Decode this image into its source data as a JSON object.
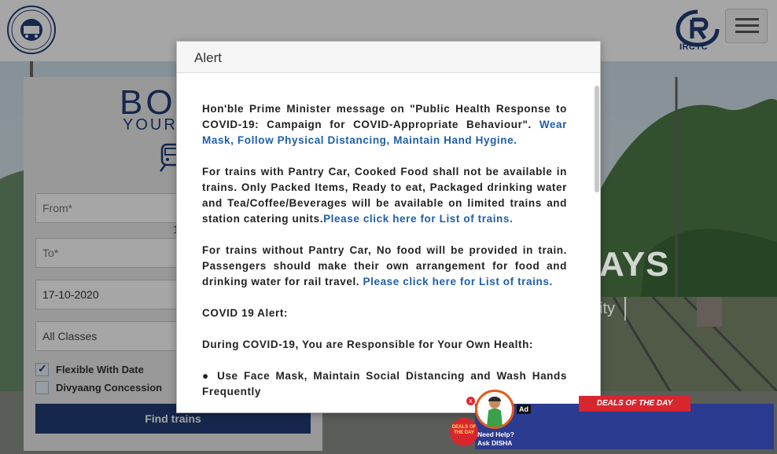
{
  "header": {
    "irctc_label": "IRCTC"
  },
  "booking": {
    "title": "BOOK",
    "subtitle": "YOUR TICKET",
    "from_placeholder": "From*",
    "to_placeholder": "To*",
    "date_value": "17-10-2020",
    "class_value": "All Classes",
    "flexible_label": "Flexible With Date",
    "divyaang_label": "Divyaang Concession",
    "find_button": "Find trains",
    "swap_hint": "1"
  },
  "background": {
    "railways_text": "AYS",
    "railways_sub": "ity"
  },
  "alert": {
    "title": "Alert",
    "p1_text": "Hon'ble Prime Minister message on \"Public Health Response to COVID-19: Campaign for COVID-Appropriate Behaviour\". ",
    "p1_link": "Wear Mask, Follow Physical Distancing, Maintain Hand Hygine.",
    "p2_text": "For trains with Pantry Car, Cooked Food shall not be available in trains. Only Packed Items, Ready to eat, Packaged drinking water and Tea/Coffee/Beverages will be available on limited trains and station catering units.",
    "p2_link": "Please click here for List of trains.",
    "p3_text": "For trains without Pantry Car, No food will be provided in train. Passengers should make their own arrangement for food and drinking water for rail travel. ",
    "p3_link": "Please click here for List of trains.",
    "p4_text": "COVID 19 Alert:",
    "p5_text": "During COVID-19, You are Responsible for Your Own Health:",
    "p6_bullet": "●",
    "p6_text": " Use Face Mask, Maintain Social Distancing and Wash Hands Frequently"
  },
  "ad": {
    "ad_label": "Ad",
    "deals_ribbon": "DEALS OF THE DAY",
    "deals_badge": "DEALS OF THE DAY",
    "disha_line1": "Need Help?",
    "disha_line2": "Ask DISHA",
    "close": "x"
  },
  "colors": {
    "brand_blue": "#213d77",
    "link_blue": "#1e5fa8",
    "ad_red": "#d8262f"
  }
}
